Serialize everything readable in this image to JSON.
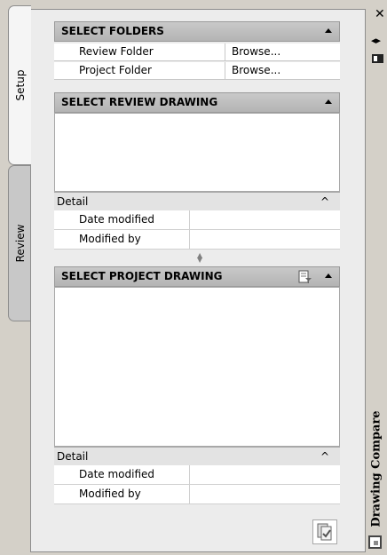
{
  "tabs": [
    {
      "label": "Setup",
      "active": true
    },
    {
      "label": "Review",
      "active": false
    }
  ],
  "select_folders": {
    "title": "SELECT FOLDERS",
    "rows": [
      {
        "label": "Review Folder",
        "button": "Browse..."
      },
      {
        "label": "Project Folder",
        "button": "Browse..."
      }
    ]
  },
  "review_drawing": {
    "title": "SELECT REVIEW DRAWING",
    "detail_label": "Detail",
    "properties": [
      "Date modified",
      "Modified by"
    ]
  },
  "project_drawing": {
    "title": "SELECT PROJECT DRAWING",
    "detail_label": "Detail",
    "properties": [
      "Date modified",
      "Modified by"
    ]
  },
  "palette": {
    "title": "Drawing Compare",
    "close_glyph": "✕",
    "autohide_glyph": "◂▸"
  },
  "icons": [
    "close-icon",
    "auto-hide-icon",
    "properties-icon",
    "collapse-icon",
    "filter-icon",
    "compare-icon",
    "palette-icon"
  ]
}
